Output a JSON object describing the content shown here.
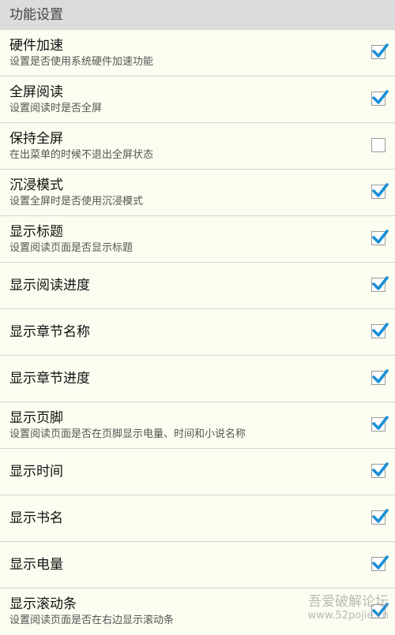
{
  "section_header": "功能设置",
  "colors": {
    "background": "#fbfdf0",
    "header_bg": "#dcdcdc",
    "check_accent": "#1a8fd6"
  },
  "settings": [
    {
      "title": "硬件加速",
      "description": "设置是否使用系统硬件加速功能",
      "checked": true
    },
    {
      "title": "全屏阅读",
      "description": "设置阅读时是否全屏",
      "checked": true
    },
    {
      "title": "保持全屏",
      "description": "在出菜单的时候不退出全屏状态",
      "checked": false
    },
    {
      "title": "沉浸模式",
      "description": "设置全屏时是否使用沉浸模式",
      "checked": true
    },
    {
      "title": "显示标题",
      "description": "设置阅读页面是否显示标题",
      "checked": true
    },
    {
      "title": "显示阅读进度",
      "description": "",
      "checked": true
    },
    {
      "title": "显示章节名称",
      "description": "",
      "checked": true
    },
    {
      "title": "显示章节进度",
      "description": "",
      "checked": true
    },
    {
      "title": "显示页脚",
      "description": "设置阅读页面是否在页脚显示电量、时间和小说名称",
      "checked": true
    },
    {
      "title": "显示时间",
      "description": "",
      "checked": true
    },
    {
      "title": "显示书名",
      "description": "",
      "checked": true
    },
    {
      "title": "显示电量",
      "description": "",
      "checked": true
    },
    {
      "title": "显示滚动条",
      "description": "设置阅读页面是否在右边显示滚动条",
      "checked": true
    }
  ],
  "watermark": {
    "title": "吾爱破解论坛",
    "url": "www.52pojie.cn"
  }
}
